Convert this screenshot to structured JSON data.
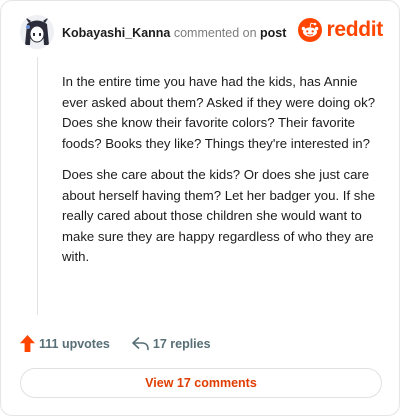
{
  "comment": {
    "username": "Kobayashi_Kanna",
    "commented_on": "commented on",
    "post_link": "post",
    "avatar_icon": "anime-avatar-icon",
    "paragraphs": [
      "In the entire time you have had the kids, has Annie ever asked about them? Asked if they were doing ok? Does she know their favorite colors? Their favorite foods? Books they like? Things they're interested in?",
      "Does she care about the kids? Or does she just care about herself having them? Let her badger you. If she really cared about those children she would want to make sure they are happy regardless of who they are with."
    ]
  },
  "brand": {
    "name": "reddit",
    "icon": "reddit-snoo-icon",
    "color": "#ff4500"
  },
  "actions": {
    "upvotes": "111 upvotes",
    "upvote_icon": "upvote-arrow-icon",
    "upvote_color": "#ff4500",
    "replies": "17 replies",
    "reply_icon": "reply-arrow-icon"
  },
  "view_comments": {
    "label": "View 17 comments",
    "color": "#e03d00"
  }
}
